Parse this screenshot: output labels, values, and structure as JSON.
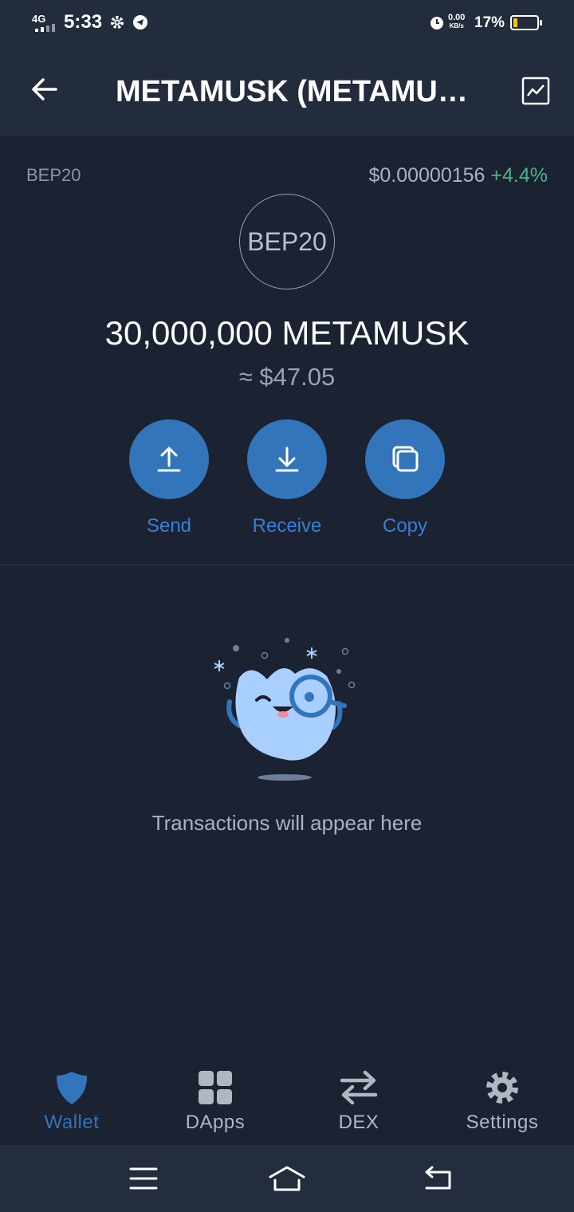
{
  "status_bar": {
    "network": "4G",
    "time": "5:33",
    "speed_value": "0.00",
    "speed_unit": "KB/s",
    "battery_percent": "17%",
    "battery_level": 0.17
  },
  "header": {
    "title": "METAMUSK (METAMUSK)",
    "back_icon": "arrow-left-icon",
    "chart_icon": "chart-icon"
  },
  "token": {
    "network": "BEP20",
    "price": "$0.00000156",
    "change": "+4.4%",
    "logo_text": "BEP20",
    "balance": "30,000,000 METAMUSK",
    "fiat_value": "≈ $47.05"
  },
  "actions": [
    {
      "label": "Send",
      "icon": "upload-icon"
    },
    {
      "label": "Receive",
      "icon": "download-icon"
    },
    {
      "label": "Copy",
      "icon": "copy-icon"
    }
  ],
  "empty_state": {
    "message": "Transactions will appear here"
  },
  "tabs": [
    {
      "label": "Wallet",
      "icon": "shield-icon",
      "active": true
    },
    {
      "label": "DApps",
      "icon": "grid-icon",
      "active": false
    },
    {
      "label": "DEX",
      "icon": "swap-icon",
      "active": false
    },
    {
      "label": "Settings",
      "icon": "gear-icon",
      "active": false
    }
  ],
  "colors": {
    "background": "#1b2231",
    "header": "#222c3c",
    "accent": "#3375bb",
    "positive": "#4db28c",
    "battery": "#f5c217"
  }
}
